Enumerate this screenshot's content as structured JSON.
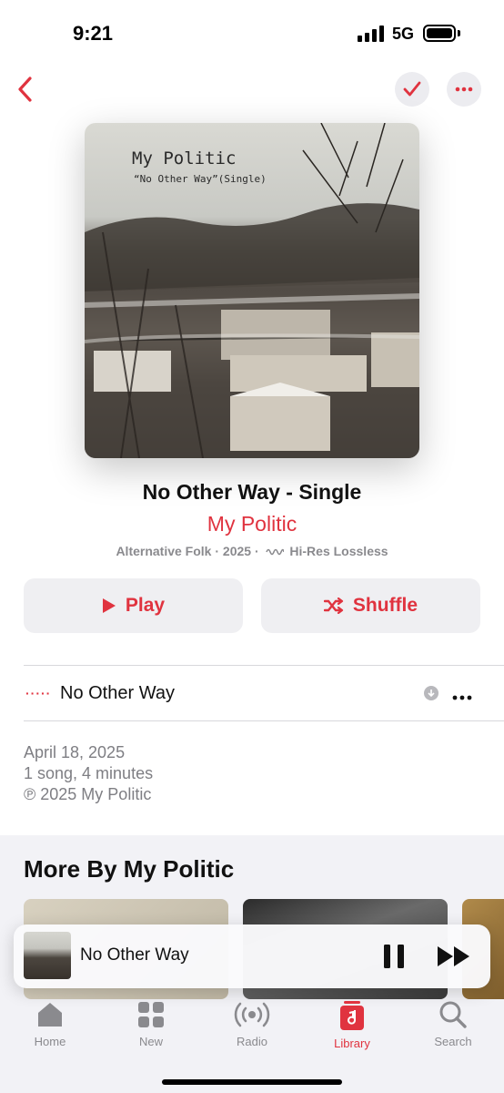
{
  "status_bar": {
    "time": "9:21",
    "network": "5G"
  },
  "album": {
    "title": "No Other Way - Single",
    "artist": "My Politic",
    "genre_year": "Alternative Folk · 2025 ·",
    "quality": "Hi-Res Lossless",
    "artwork_title": "My Politic",
    "artwork_subtitle": "“No Other Way”(Single)"
  },
  "actions": {
    "play_label": "Play",
    "shuffle_label": "Shuffle"
  },
  "tracks": [
    {
      "title": "No Other Way"
    }
  ],
  "info": {
    "release_date": "April 18, 2025",
    "summary": "1 song, 4 minutes",
    "copyright": "℗ 2025 My Politic"
  },
  "more_by": {
    "title": "More By My Politic"
  },
  "now_playing": {
    "title": "No Other Way"
  },
  "tab_bar": {
    "items": [
      {
        "label": "Home",
        "icon": "home-icon"
      },
      {
        "label": "New",
        "icon": "grid-icon"
      },
      {
        "label": "Radio",
        "icon": "radio-icon"
      },
      {
        "label": "Library",
        "icon": "library-icon"
      },
      {
        "label": "Search",
        "icon": "search-icon"
      }
    ],
    "active": "Library"
  },
  "colors": {
    "accent": "#e0333f",
    "secondary_text": "#8a8a8e",
    "button_bg": "#efeff2"
  }
}
